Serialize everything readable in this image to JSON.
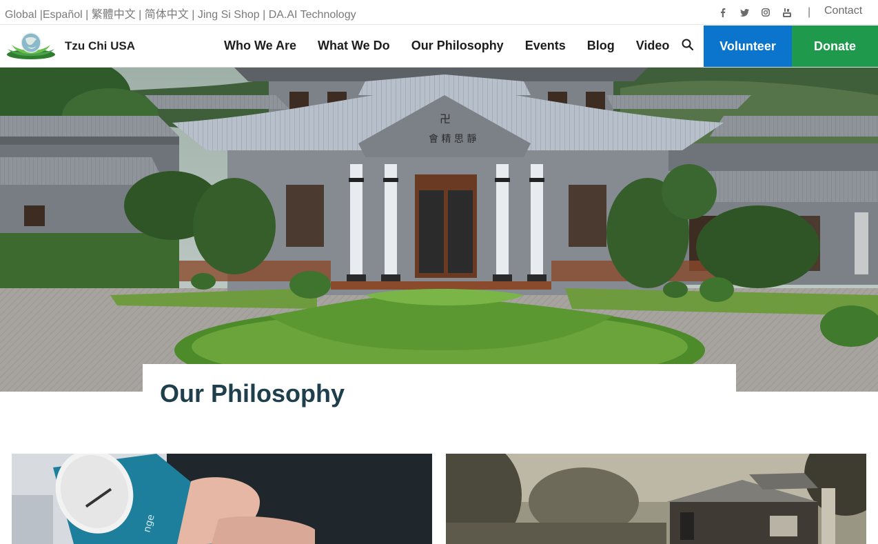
{
  "topbar": {
    "lang_links": "Global |Español | 繁體中文 | 简体中文 | Jing Si Shop | DA.AI Technology",
    "social_icons": [
      "facebook-icon",
      "twitter-icon",
      "instagram-icon",
      "youtube-icon"
    ],
    "separator": "|",
    "contact_label": "Contact"
  },
  "header": {
    "brand": "Tzu Chi USA",
    "nav": [
      "Who We Are",
      "What We Do",
      "Our Philosophy",
      "Events",
      "Blog",
      "Video"
    ],
    "volunteer_label": "Volunteer",
    "donate_label": "Donate"
  },
  "hero": {
    "page_title": "Our Philosophy"
  },
  "colors": {
    "volunteer": "#0b74cc",
    "donate": "#1f9a4d",
    "title": "#1f3f4d"
  }
}
